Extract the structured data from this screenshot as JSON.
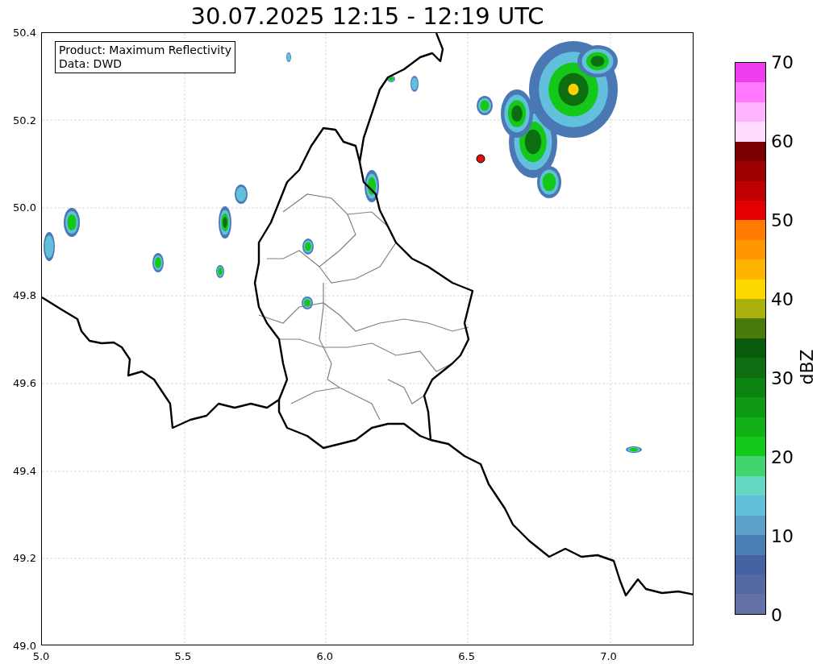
{
  "title": "30.07.2025 12:15 - 12:19 UTC",
  "info": [
    "Product: Maximum Reflectivity",
    "Data: DWD"
  ],
  "y_ticks": [
    "50.4",
    "50.2",
    "50.0",
    "49.8",
    "49.6",
    "49.4",
    "49.2",
    "49.0"
  ],
  "x_ticks": [
    "5.0",
    "5.5",
    "6.0",
    "6.5",
    "7.0"
  ],
  "colorbar": {
    "label": "dBZ",
    "ticks": [
      "70",
      "60",
      "50",
      "40",
      "30",
      "20",
      "10",
      "0"
    ],
    "segments": [
      {
        "color": "#ee3cee"
      },
      {
        "color": "#ff78ff"
      },
      {
        "color": "#ffb4ff"
      },
      {
        "color": "#ffdcff"
      },
      {
        "color": "#780000"
      },
      {
        "color": "#9c0000"
      },
      {
        "color": "#c00000"
      },
      {
        "color": "#e40000"
      },
      {
        "color": "#ff7c00"
      },
      {
        "color": "#ff9800"
      },
      {
        "color": "#ffb400"
      },
      {
        "color": "#ffd800"
      },
      {
        "color": "#aab00c"
      },
      {
        "color": "#4a7a0c"
      },
      {
        "color": "#0a5a0e"
      },
      {
        "color": "#0c6e10"
      },
      {
        "color": "#0c8412"
      },
      {
        "color": "#0e9a14"
      },
      {
        "color": "#10b016"
      },
      {
        "color": "#14c81a"
      },
      {
        "color": "#40d46c"
      },
      {
        "color": "#64d8c4"
      },
      {
        "color": "#62c0dc"
      },
      {
        "color": "#5aa0c8"
      },
      {
        "color": "#4a80b4"
      },
      {
        "color": "#4662a2"
      },
      {
        "color": "#5468a2"
      },
      {
        "color": "#6272a6"
      }
    ]
  }
}
